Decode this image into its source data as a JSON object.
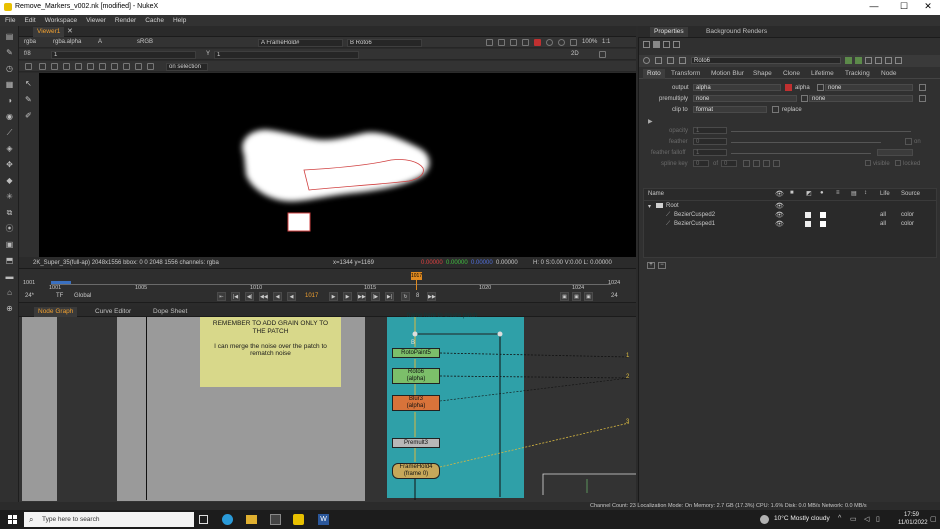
{
  "window": {
    "title": "Remove_Markers_v002.nk [modified] - NukeX"
  },
  "menu": [
    "File",
    "Edit",
    "Workspace",
    "Viewer",
    "Render",
    "Cache",
    "Help"
  ],
  "viewer": {
    "tab": "Viewer1",
    "channels": "rgba",
    "channel_layer": "rgba.alpha",
    "channel_A": "A",
    "colorspace": "sRGB",
    "input_a": "A  FrameHold#",
    "input_b": "B  Roto6",
    "zoom": "100%",
    "ratio": "1:1",
    "fstop": "f/8",
    "frame_field": "1",
    "y_label": "Y",
    "y_value": "1",
    "view_mode": "2D",
    "selection": "on selection",
    "info_format": "2K_Super_35(full-ap) 2048x1556  bbox: 0 0 2048 1556 channels: rgba",
    "info_coords": "x=1344 y=1169",
    "info_rgb": [
      "0.00000",
      "0.00000",
      "0.00000",
      "0.00000"
    ],
    "info_hsvl": "H:  0 S:0.00 V:0.00   L: 0.00000"
  },
  "timeline": {
    "fps": "24*",
    "tf": "TF",
    "range": "Global",
    "start": "1001",
    "end": "1024",
    "current_frame": "1017",
    "marker": "1017",
    "ticks": [
      "1001",
      "1005",
      "1010",
      "1015",
      "1020",
      "1024"
    ],
    "step": "8",
    "increment": "24"
  },
  "node_graph_tabs": [
    "Node Graph",
    "Curve Editor",
    "Dope Sheet"
  ],
  "sticky_note": "REMEMBER TO ADD GRAIN ONLY TO THE PATCH\n\nI can merge the noise over the patch to rematch noise",
  "nodes": [
    {
      "label": "RotoPaint5",
      "color": "#7cbf6a"
    },
    {
      "label": "Roto6\n(alpha)",
      "color": "#7cbf6a"
    },
    {
      "label": "Blur3\n(alpha)",
      "color": "#d8733a"
    },
    {
      "label": "Premult3",
      "color": "#b8b8b8"
    },
    {
      "label": "FrameHold4\n(frame 0)",
      "color": "#c7a85a"
    }
  ],
  "backdrop_text": "frame here to create patch",
  "pipe_numbers": [
    "1",
    "2",
    "3"
  ],
  "node_label_b": "B",
  "properties": {
    "tabs": [
      "Properties",
      "Background Renders"
    ],
    "node_name": "Roto6",
    "subtabs": [
      "Roto",
      "Transform",
      "Motion Blur",
      "Shape",
      "Clone",
      "Lifetime",
      "Tracking",
      "Node"
    ],
    "output_label": "output",
    "output_value": "alpha",
    "output_alpha": "alpha",
    "output_none": "none",
    "premultiply_label": "premultiply",
    "premultiply_value": "none",
    "premultiply_none": "none",
    "clipto_label": "clip to",
    "clipto_value": "format",
    "replace_label": "replace",
    "opacity_label": "opacity",
    "opacity_value": "1",
    "feather_label": "feather",
    "feather_value": "0",
    "on_label": "on",
    "feather_falloff_label": "feather falloff",
    "feather_falloff_value": "1",
    "spline_key_label": "spline key",
    "spline_key_value": "0",
    "of_label": "of",
    "of_value": "0",
    "visible_label": "visible",
    "locked_label": "locked",
    "tree_headers": [
      "Name",
      "Life",
      "Source"
    ],
    "tree": [
      {
        "name": "Root",
        "life": "",
        "source": ""
      },
      {
        "name": "BezierCusped2",
        "life": "all",
        "source": "color"
      },
      {
        "name": "BezierCusped1",
        "life": "all",
        "source": "color"
      }
    ]
  },
  "status": "Channel Count: 23  Localization Mode: On  Memory: 2.7 GB (17.3%)  CPU: 1.6%  Disk: 0.0 MB/s  Network: 0.0 MB/s",
  "taskbar": {
    "search_placeholder": "Type here to search",
    "weather": "10°C  Mostly cloudy",
    "time": "17:59",
    "date": "11/01/2022"
  }
}
